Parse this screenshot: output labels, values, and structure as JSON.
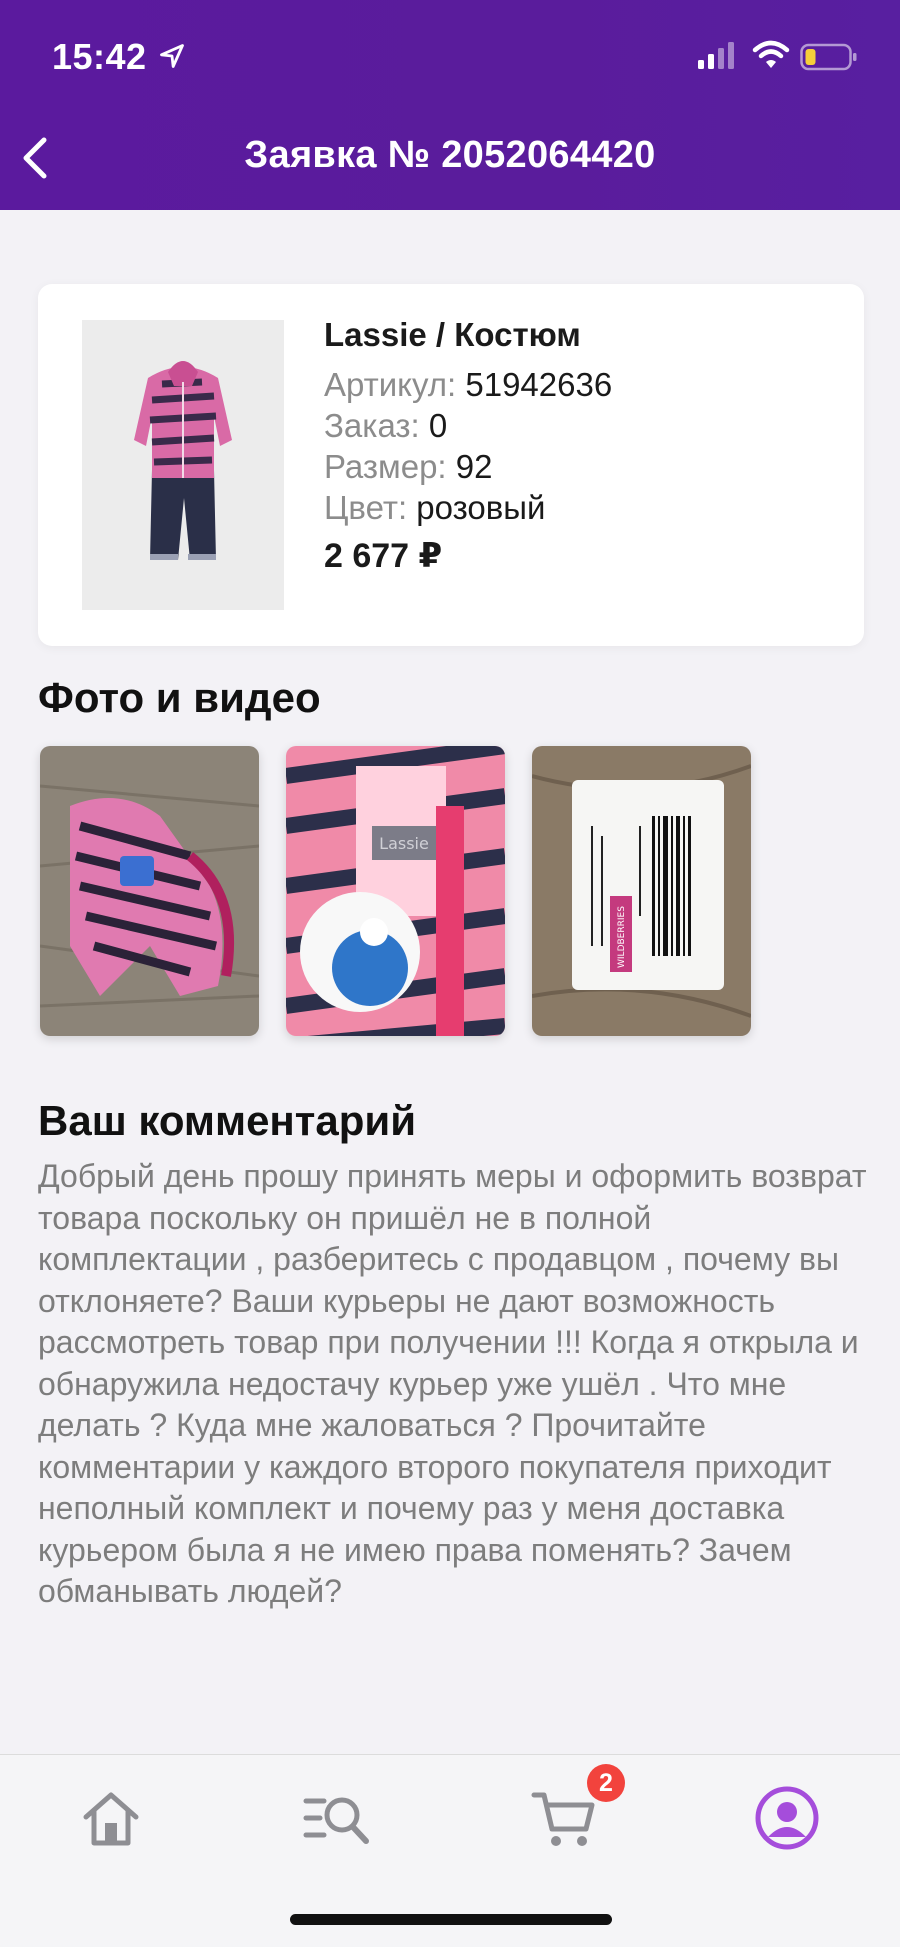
{
  "status_bar": {
    "time": "15:42"
  },
  "nav": {
    "title": "Заявка № 2052064420"
  },
  "product": {
    "name": "Lassie / Костюм",
    "article_label": "Артикул:",
    "article_value": "51942636",
    "order_label": "Заказ:",
    "order_value": "0",
    "size_label": "Размер:",
    "size_value": "92",
    "color_label": "Цвет:",
    "color_value": "розовый",
    "price": "2 677 ₽"
  },
  "media": {
    "title": "Фото и видео",
    "photos": [
      {
        "alt": "Куртка в полоску на полу"
      },
      {
        "alt": "Ярлык Lassie крупным планом"
      },
      {
        "alt": "Упаковка с этикеткой Wildberries"
      }
    ],
    "photo3_label": "WILDBERRIES"
  },
  "comment": {
    "title": "Ваш комментарий",
    "text": "Добрый день прошу принять меры и оформить возврат товара поскольку он пришёл не в полной комплектации , разберитесь с продавцом , почему вы отклоняете? Ваши курьеры не дают возможность рассмотреть товар при получении !!! Когда я открыла и обнаружила недостачу курьер уже ушёл . Что мне делать ? Куда мне жаловаться ? Прочитайте комментарии у каждого второго покупателя приходит неполный комплект и почему раз у меня доставка курьером была я не имею права поменять? Зачем обманывать людей?"
  },
  "tabbar": {
    "items": [
      {
        "icon": "home-icon"
      },
      {
        "icon": "catalog-search-icon"
      },
      {
        "icon": "cart-icon"
      },
      {
        "icon": "profile-icon"
      }
    ],
    "cart_badge": "2",
    "active_color": "#a54ddb",
    "inactive_color": "#8e8e93"
  },
  "colors": {
    "header": "#5a1c9c",
    "background": "#f3f2f6"
  }
}
